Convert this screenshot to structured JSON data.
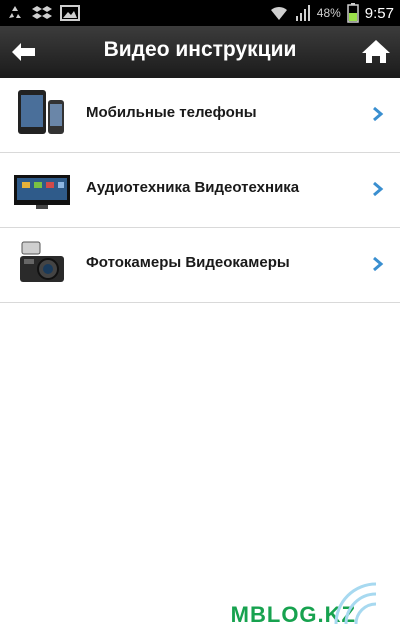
{
  "status_bar": {
    "battery_percent": "48%",
    "time": "9:57",
    "icons": [
      "recycle-icon",
      "dropbox-icon",
      "image-icon",
      "wifi-icon",
      "signal-icon",
      "battery-icon"
    ]
  },
  "header": {
    "title": "Видео инструкции",
    "back_icon": "arrow-left-icon",
    "home_icon": "home-icon"
  },
  "categories": [
    {
      "label": "Мобильные телефоны",
      "icon": "phones-icon"
    },
    {
      "label": "Аудиотехника Видеотехника",
      "icon": "tv-icon"
    },
    {
      "label": "Фотокамеры Видеокамеры",
      "icon": "camera-icon"
    }
  ],
  "watermark": {
    "text": "MBLOG.KZ"
  },
  "colors": {
    "status_bar": "#000000",
    "action_bar": "#2a2a2a",
    "chevron": "#3a8fd0",
    "watermark": "#17a24f",
    "divider": "#d9d9d9"
  }
}
